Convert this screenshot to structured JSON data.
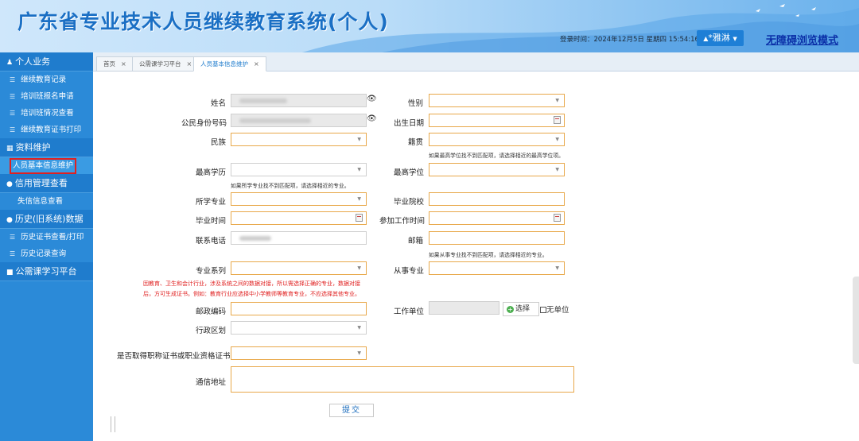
{
  "header": {
    "title": "广东省专业技术人员继续教育系统(个人)",
    "login_time": "登录时间：2024年12月5日   星期四   15:54:16",
    "user_name": "*雅淋",
    "access_mode": "无障碍浏览模式"
  },
  "sidebar": {
    "groups": [
      {
        "label": "个人业务",
        "items": [
          "继续教育记录",
          "培训班报名申请",
          "培训班情况查看",
          "继续教育证书打印"
        ]
      },
      {
        "label": "资料维护",
        "items": [
          "人员基本信息维护"
        ]
      },
      {
        "label": "信用管理查看",
        "items": [
          "失信信息查看"
        ]
      },
      {
        "label": "历史(旧系统)数据",
        "items": [
          "历史证书查看/打印",
          "历史记录查询"
        ]
      },
      {
        "label": "公需课学习平台",
        "items": []
      }
    ]
  },
  "tabs": [
    "首页",
    "公需课学习平台",
    "人员基本信息维护"
  ],
  "form": {
    "name": "姓名",
    "gender": "性别",
    "id_no": "公民身份号码",
    "birth": "出生日期",
    "nation": "民族",
    "native": "籍贯",
    "degree_hint": "如果最高学位找不到匹配项，请选择相近的最高学位项。",
    "edu": "最高学历",
    "degree": "最高学位",
    "major_hint": "如果所学专业找不到匹配项，请选择相近的专业。",
    "major": "所学专业",
    "school": "毕业院校",
    "grad_time": "毕业时间",
    "work_time": "参加工作时间",
    "phone": "联系电话",
    "email": "邮箱",
    "work_major_hint": "如果从事专业找不到匹配项，请选择相近的专业。",
    "series": "专业系列",
    "work_major": "从事专业",
    "warn": "因教育、卫生和会计行业，涉及系统之间的数据对接，所以需选择正确的专业，数据对接后，方可生成证书。例如：教育行业应选择中小学教师等教育专业，不应选择其他专业。",
    "postcode": "邮政编码",
    "work_unit": "工作单位",
    "pick": "选择",
    "no_unit": "无单位",
    "district": "行政区划",
    "cert": "是否取得职称证书或职业资格证书",
    "address": "通信地址",
    "submit": "提交"
  }
}
